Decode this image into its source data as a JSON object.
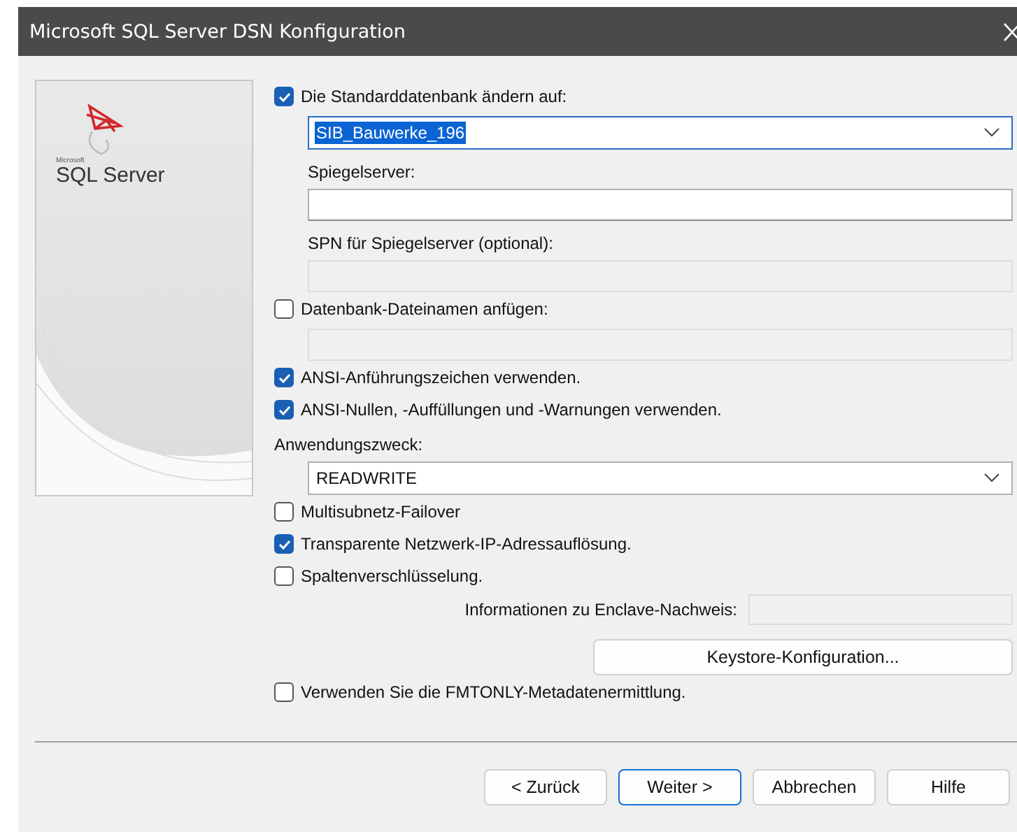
{
  "window": {
    "title": "Microsoft SQL Server DSN Konfiguration"
  },
  "logo": {
    "brand": "Microsoft",
    "product": "SQL Server"
  },
  "items": [
    {
      "kind": "checkbox",
      "label": "Die Standarddatenbank ändern auf:",
      "checked": true
    },
    {
      "kind": "combo",
      "value": "SIB_Bauwerke_196",
      "selected": true
    },
    {
      "kind": "label",
      "text": "Spiegelserver:"
    },
    {
      "kind": "field",
      "disabled": false
    },
    {
      "kind": "label",
      "text": "SPN für Spiegelserver (optional):"
    },
    {
      "kind": "field",
      "disabled": true
    },
    {
      "kind": "checkbox",
      "label": "Datenbank-Dateinamen anfügen:",
      "checked": false
    },
    {
      "kind": "field",
      "disabled": true
    },
    {
      "kind": "checkbox",
      "label": "ANSI-Anführungszeichen verwenden.",
      "checked": true
    },
    {
      "kind": "checkbox",
      "label": "ANSI-Nullen, -Auffüllungen und -Warnungen verwenden.",
      "checked": true
    },
    {
      "kind": "heading",
      "text": "Anwendungszweck:"
    },
    {
      "kind": "combo",
      "value": "READWRITE",
      "selected": false
    },
    {
      "kind": "checkbox",
      "label": "Multisubnetz-Failover",
      "checked": false
    },
    {
      "kind": "checkbox",
      "label": "Transparente Netzwerk-IP-Adressauflösung.",
      "checked": true
    },
    {
      "kind": "checkbox",
      "label": "Spaltenverschlüsselung.",
      "checked": false
    },
    {
      "kind": "inline_field",
      "label": "Informationen zu Enclave-Nachweis:",
      "disabled": true
    },
    {
      "kind": "button",
      "label": "Keystore-Konfiguration..."
    },
    {
      "kind": "checkbox",
      "label": "Verwenden Sie die FMTONLY-Metadatenermittlung.",
      "checked": false
    }
  ],
  "buttons": [
    {
      "label": "< Zurück",
      "default": false
    },
    {
      "label": "Weiter >",
      "default": true
    },
    {
      "label": "Abbrechen",
      "default": false
    },
    {
      "label": "Hilfe",
      "default": false
    }
  ]
}
